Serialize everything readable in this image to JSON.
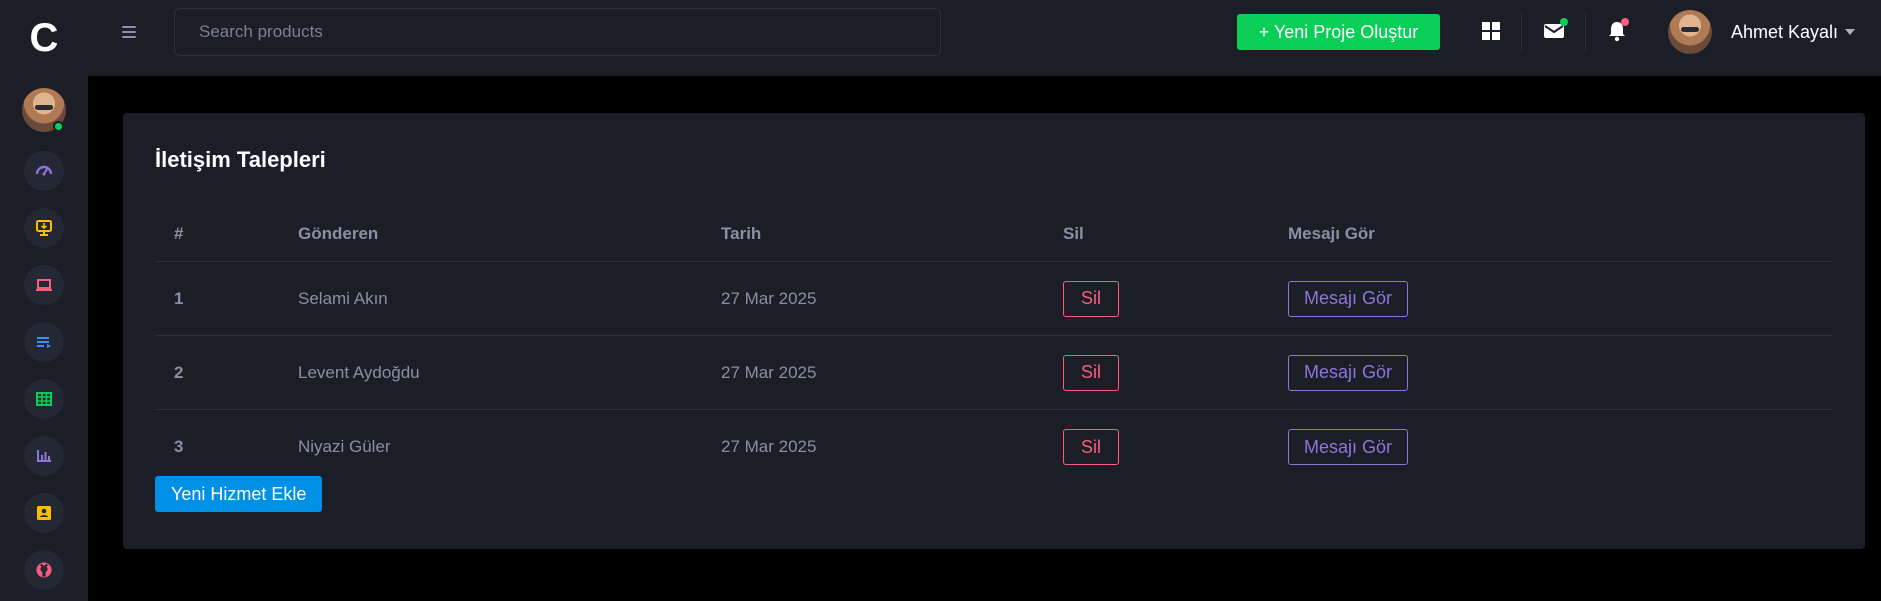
{
  "brand": {
    "logo_letter": "C"
  },
  "search": {
    "placeholder": "Search products"
  },
  "topbar": {
    "new_project_label": "+ Yeni Proje Oluştur",
    "icons": [
      "apps-grid-icon",
      "mail-icon",
      "bell-icon"
    ],
    "mail_badge_color": "#0acf57",
    "bell_badge_color": "#fa5c7c"
  },
  "user": {
    "name": "Ahmet Kayalı"
  },
  "sidebar": {
    "online_status_color": "#0acf57",
    "items": [
      {
        "name": "dashboard-icon",
        "color": "#8f75da"
      },
      {
        "name": "presentation-icon",
        "color": "#ffbc00"
      },
      {
        "name": "laptop-icon",
        "color": "#fa5c7c"
      },
      {
        "name": "list-icon",
        "color": "#3f8cff"
      },
      {
        "name": "table-icon",
        "color": "#0acf57"
      },
      {
        "name": "bar-chart-icon",
        "color": "#8f75da"
      },
      {
        "name": "contact-card-icon",
        "color": "#ffbc00"
      },
      {
        "name": "github-icon",
        "color": "#fa5c7c"
      }
    ]
  },
  "card": {
    "title": "İletişim Talepleri",
    "columns": {
      "num": "#",
      "sender": "Gönderen",
      "date": "Tarih",
      "delete": "Sil",
      "view": "Mesajı Gör"
    },
    "rows": [
      {
        "num": "1",
        "sender": "Selami Akın",
        "date": "27 Mar 2025",
        "delete_label": "Sil",
        "view_label": "Mesajı Gör"
      },
      {
        "num": "2",
        "sender": "Levent Aydoğdu",
        "date": "27 Mar 2025",
        "delete_label": "Sil",
        "view_label": "Mesajı Gör"
      },
      {
        "num": "3",
        "sender": "Niyazi Güler",
        "date": "27 Mar 2025",
        "delete_label": "Sil",
        "view_label": "Mesajı Gör"
      }
    ],
    "add_button_label": "Yeni Hizmet Ekle"
  },
  "colors": {
    "success": "#0acf57",
    "danger": "#fa5c7c",
    "purple": "#8f75da",
    "info": "#0091e6"
  }
}
